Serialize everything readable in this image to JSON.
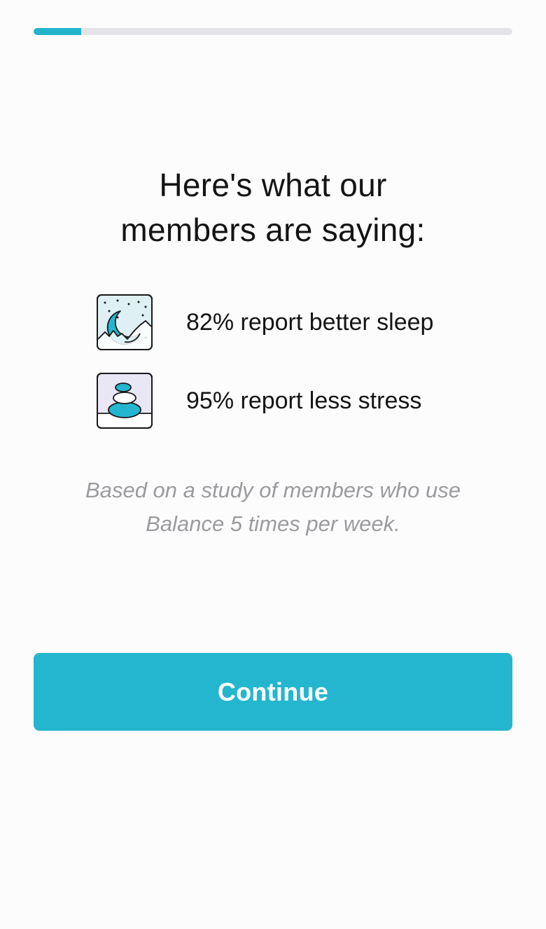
{
  "progress": {
    "fraction": 0.1,
    "fill_color": "#22b4cc",
    "track_color": "#e4e3e8"
  },
  "heading": {
    "line1": "Here's what our",
    "line2": "members are saying:"
  },
  "stats": [
    {
      "icon": "moon-night-sky-icon",
      "label": "82% report better sleep"
    },
    {
      "icon": "stacked-stones-icon",
      "label": "95% report less stress"
    }
  ],
  "footnote": {
    "line1": "Based on a study of members who use",
    "line2": "Balance 5 times per week."
  },
  "continue_button": {
    "label": "Continue",
    "color": "#24b6cf"
  }
}
